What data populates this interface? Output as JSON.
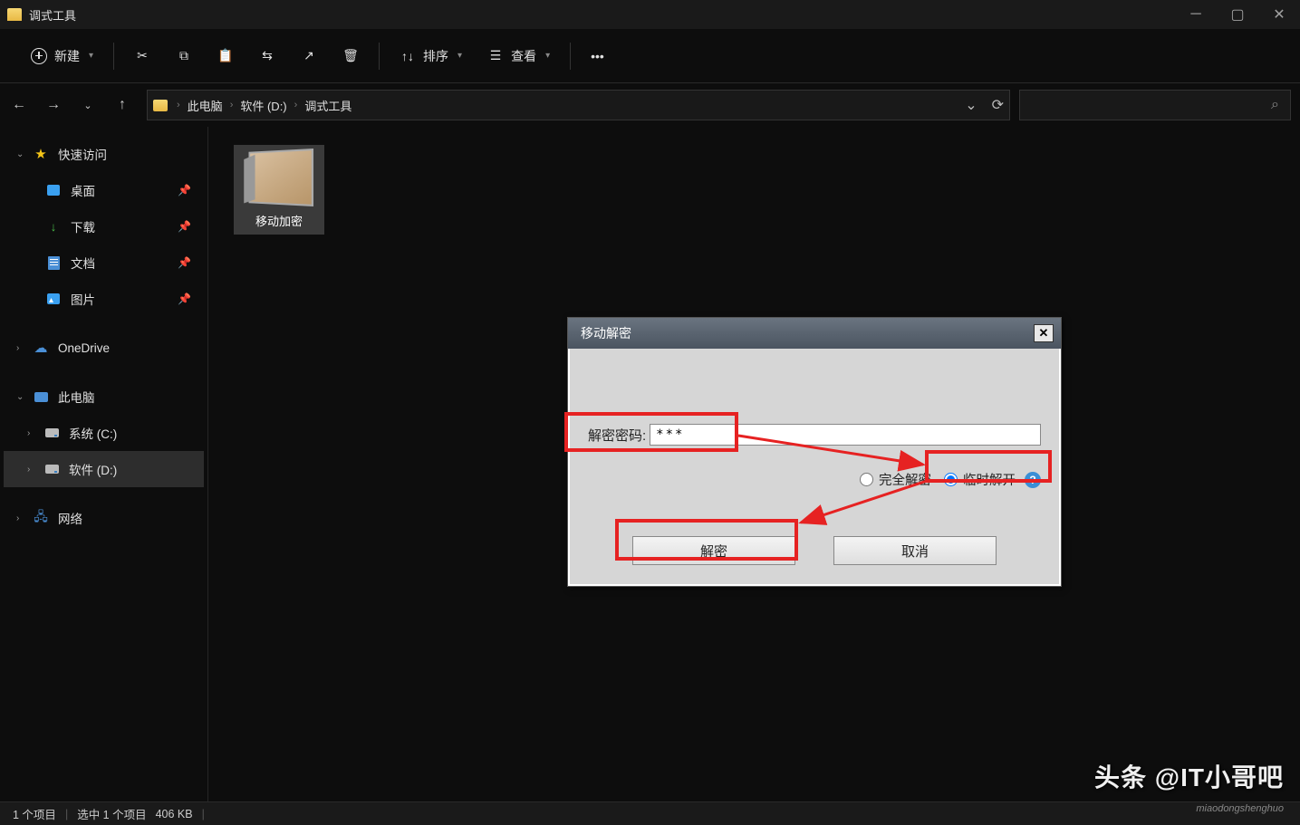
{
  "window": {
    "title": "调式工具"
  },
  "toolbar": {
    "new_label": "新建",
    "sort_label": "排序",
    "view_label": "查看"
  },
  "breadcrumb": {
    "parts": [
      "此电脑",
      "软件 (D:)",
      "调式工具"
    ]
  },
  "sidebar": {
    "quick_access": "快速访问",
    "desktop": "桌面",
    "downloads": "下载",
    "documents": "文档",
    "pictures": "图片",
    "onedrive": "OneDrive",
    "this_pc": "此电脑",
    "drive_c": "系统 (C:)",
    "drive_d": "软件 (D:)",
    "network": "网络"
  },
  "files": {
    "item0": {
      "name": "移动加密"
    }
  },
  "dialog": {
    "title": "移动解密",
    "password_label": "解密密码:",
    "password_value": "***",
    "radio_full": "完全解密",
    "radio_temp": "临时解开",
    "btn_decrypt": "解密",
    "btn_cancel": "取消"
  },
  "status": {
    "count": "1 个项目",
    "selected": "选中 1 个项目",
    "size": "406 KB"
  },
  "watermark": {
    "main": "头条 @IT小哥吧",
    "sub": "miaodongshenghuo"
  }
}
